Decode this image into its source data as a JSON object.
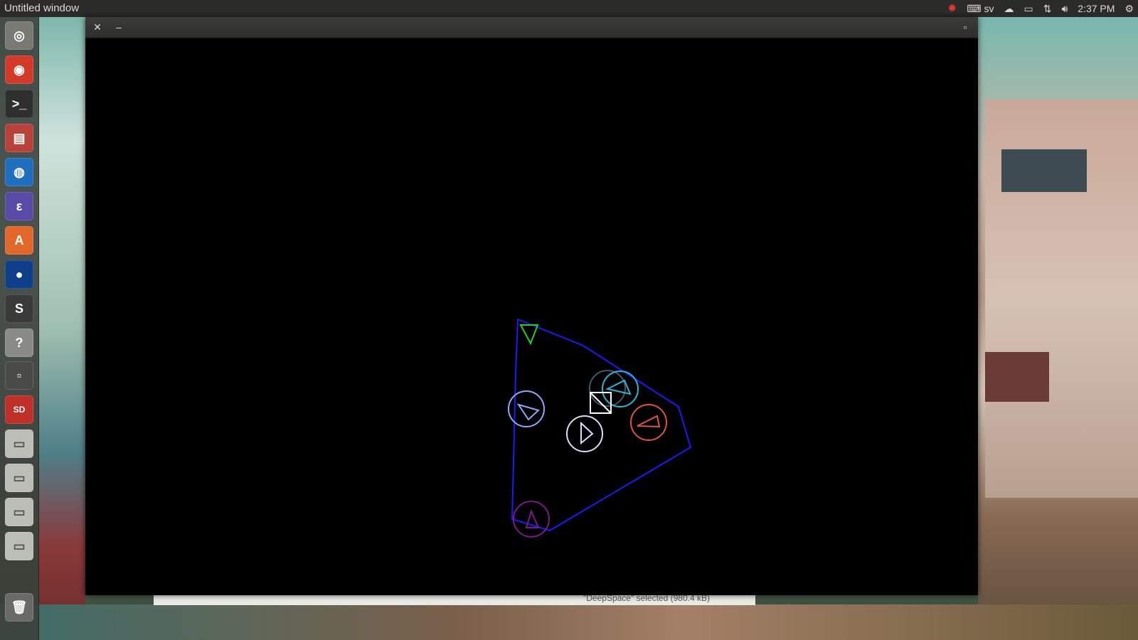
{
  "top_panel": {
    "window_title": "Untitled window",
    "indicators": {
      "keyboard_layout": "sv",
      "time": "2:37 PM"
    }
  },
  "launcher": {
    "items": [
      {
        "name": "dash-home",
        "icon": "ubuntu-logo-icon"
      },
      {
        "name": "chrome",
        "icon": "chrome-icon"
      },
      {
        "name": "terminal",
        "icon": "terminal-icon"
      },
      {
        "name": "files",
        "icon": "file-cabinet-icon"
      },
      {
        "name": "web-browser",
        "icon": "globe-icon"
      },
      {
        "name": "emacs",
        "icon": "emacs-icon"
      },
      {
        "name": "software-center",
        "icon": "shopping-bag-icon",
        "glyph": "A"
      },
      {
        "name": "earth",
        "icon": "earth-icon"
      },
      {
        "name": "sublime-text",
        "icon": "sublime-icon",
        "glyph": "S"
      },
      {
        "name": "help",
        "icon": "help-icon",
        "glyph": "?"
      },
      {
        "name": "workspace-switcher",
        "icon": "workspace-icon"
      },
      {
        "name": "sd-card",
        "icon": "sd-card-icon",
        "glyph": "SD"
      },
      {
        "name": "drive-1",
        "icon": "drive-icon"
      },
      {
        "name": "drive-2",
        "icon": "drive-icon"
      },
      {
        "name": "drive-3",
        "icon": "drive-icon"
      },
      {
        "name": "drive-4",
        "icon": "drive-icon"
      },
      {
        "name": "trash",
        "icon": "trash-icon"
      }
    ]
  },
  "window": {
    "close_icon": "✕",
    "minimize_icon": "–",
    "maximize_icon": "▫"
  },
  "background_window": {
    "status_text": "\"DeepSpace\" selected (980.4 kB)"
  },
  "colors": {
    "boundary": "#1a1aff",
    "green_ship": "#1fd21f",
    "blue_ship": "#8fa8ff",
    "white_ship": "#dcdcff",
    "teal_ship": "#27b8d6",
    "gray_ship": "#3f5a6a",
    "orange_ship": "#e0553a",
    "purple_ship": "#7a1a8a",
    "target_box": "#ffffff",
    "alert": "#e3342a"
  }
}
